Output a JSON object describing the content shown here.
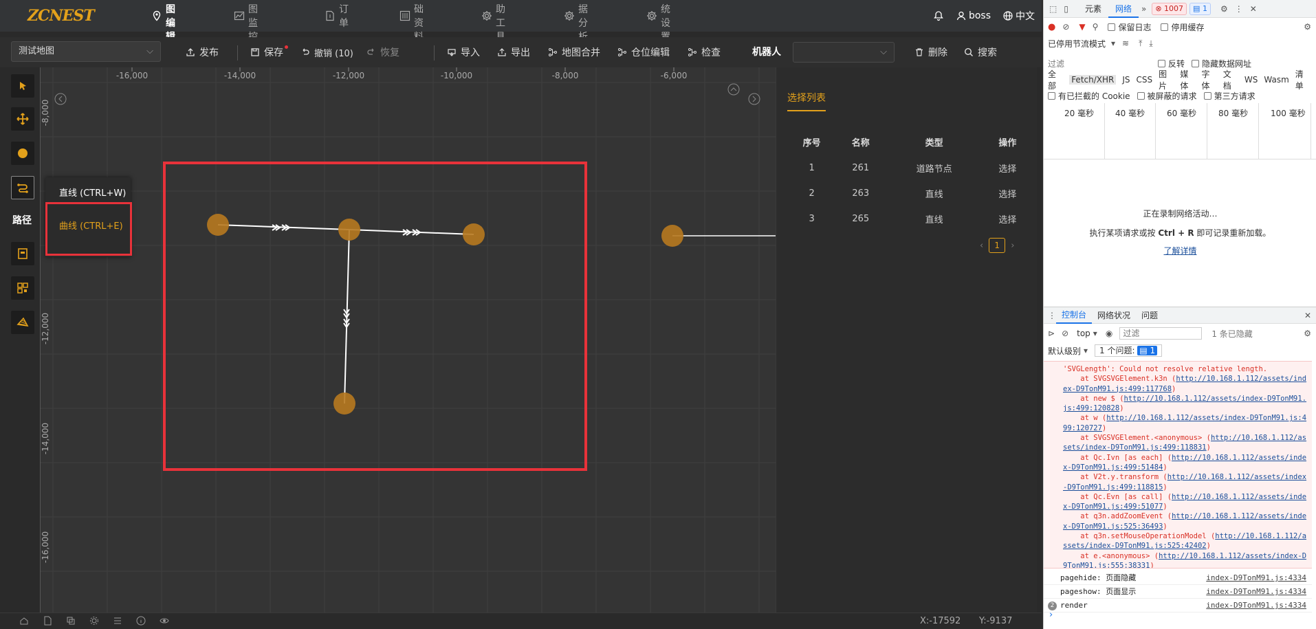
{
  "app": {
    "logo": "ZCNEST",
    "nav": [
      {
        "label": "地图编辑",
        "icon": "map-pin-icon",
        "active": true
      },
      {
        "label": "地图监控",
        "icon": "chart-icon",
        "active": false
      },
      {
        "label": "订单",
        "icon": "document-icon",
        "active": false
      },
      {
        "label": "基础资料",
        "icon": "sliders-icon",
        "active": false
      },
      {
        "label": "辅助工具",
        "icon": "gear-icon",
        "active": false
      },
      {
        "label": "数据分析",
        "icon": "gear-icon",
        "active": false
      },
      {
        "label": "系统设置",
        "icon": "gear-icon",
        "active": false
      }
    ],
    "user": "boss",
    "language": "中文"
  },
  "toolbar": {
    "map_select": "测试地图",
    "publish": "发布",
    "save": "保存",
    "undo": "撤销 (10)",
    "redo": "恢复",
    "import": "导入",
    "export": "导出",
    "merge": "地图合并",
    "location_edit": "仓位编辑",
    "check": "检查",
    "robot_label": "机器人",
    "robot_select": "",
    "delete": "删除",
    "search": "搜索"
  },
  "tools": {
    "active_label": "路径",
    "popover": {
      "line": "直线 (CTRL+W)",
      "curve": "曲线 (CTRL+E)"
    }
  },
  "canvas": {
    "x_ticks": [
      "-16,000",
      "-14,000",
      "-12,000",
      "-10,000",
      "-8,000",
      "-6,000"
    ],
    "y_ticks": [
      "-8,000",
      "-12,000",
      "-14,000",
      "-16,000"
    ],
    "accent_color": "#e3a11b",
    "highlight_color": "#e8323a"
  },
  "selection": {
    "title": "选择列表",
    "columns": [
      "序号",
      "名称",
      "类型",
      "操作"
    ],
    "rows": [
      {
        "index": "1",
        "name": "261",
        "type": "道路节点",
        "action": "选择"
      },
      {
        "index": "2",
        "name": "263",
        "type": "直线",
        "action": "选择"
      },
      {
        "index": "3",
        "name": "265",
        "type": "直线",
        "action": "选择"
      }
    ],
    "page": "1"
  },
  "status": {
    "x": "X:-17592",
    "y": "Y:-9137"
  },
  "devtools": {
    "tabs": [
      "元素",
      "网络"
    ],
    "error_count": "1007",
    "info_count": "1",
    "throttle": "已停用节流模式",
    "preserve_log": "保留日志",
    "disable_cache": "停用缓存",
    "filter_placeholder": "过滤",
    "invert": "反转",
    "hide_data_urls": "隐藏数据网址",
    "type_filters": [
      "全部",
      "Fetch/XHR",
      "JS",
      "CSS",
      "图片",
      "媒体",
      "字体",
      "文档",
      "WS",
      "Wasm",
      "清单"
    ],
    "cookie_filters": [
      "有已拦截的 Cookie",
      "被屏蔽的请求",
      "第三方请求"
    ],
    "timeline": [
      "20 毫秒",
      "40 毫秒",
      "60 毫秒",
      "80 毫秒",
      "100 毫秒"
    ],
    "recording": "正在录制网络活动…",
    "hint_pre": "执行某项请求或按 ",
    "hint_key": "Ctrl + R",
    "hint_post": " 即可记录重新加载。",
    "learn_more": "了解详情",
    "console_tabs": [
      "控制台",
      "网络状况",
      "问题"
    ],
    "context": "top",
    "console_filter": "过滤",
    "hidden_count": "1 条已隐藏",
    "level": "默认级别",
    "issues": "1 个问题:",
    "issues_badge": "1",
    "error_lines": [
      {
        "pre": "'SVGLength': Could not resolve relative length.",
        "link": ""
      },
      {
        "pre": "    at SVGSVGElement.k3n (",
        "link": "http://10.168.1.112/assets/index-D9TonM91.js:499:117768",
        "post": ")"
      },
      {
        "pre": "    at new $ (",
        "link": "http://10.168.1.112/assets/index-D9TonM91.js:499:120828",
        "post": ")"
      },
      {
        "pre": "    at w (",
        "link": "http://10.168.1.112/assets/index-D9TonM91.js:499:120727",
        "post": ")"
      },
      {
        "pre": "    at SVGSVGElement.<anonymous> (",
        "link": "http://10.168.1.112/assets/index-D9TonM91.js:499:118831",
        "post": ")"
      },
      {
        "pre": "    at Qc.Ivn [as each] (",
        "link": "http://10.168.1.112/assets/index-D9TonM91.js:499:51484",
        "post": ")"
      },
      {
        "pre": "    at V2t.y.transform (",
        "link": "http://10.168.1.112/assets/index-D9TonM91.js:499:118815",
        "post": ")"
      },
      {
        "pre": "    at Qc.Evn [as call] (",
        "link": "http://10.168.1.112/assets/index-D9TonM91.js:499:51077",
        "post": ")"
      },
      {
        "pre": "    at q3n.addZoomEvent (",
        "link": "http://10.168.1.112/assets/index-D9TonM91.js:525:36493",
        "post": ")"
      },
      {
        "pre": "    at q3n.setMouseOperationModel (",
        "link": "http://10.168.1.112/assets/index-D9TonM91.js:525:42402",
        "post": ")"
      },
      {
        "pre": "    at e.<anonymous> (",
        "link": "http://10.168.1.112/assets/index-D9TonM91.js:555:38331",
        "post": ")"
      }
    ],
    "logs": [
      {
        "text": "pagehide: 页面隐藏",
        "src": "index-D9TonM91.js:4334"
      },
      {
        "text": "pageshow: 页面显示",
        "src": "index-D9TonM91.js:4334"
      },
      {
        "text": "render",
        "src": "index-D9TonM91.js:4334",
        "count": "2"
      }
    ]
  }
}
